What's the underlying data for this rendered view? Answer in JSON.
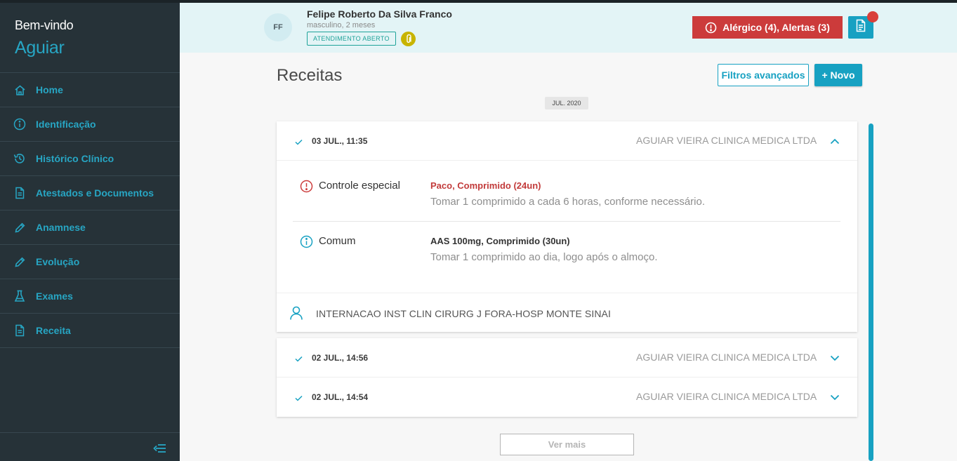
{
  "sidebar": {
    "welcome": "Bem-vindo",
    "user": "Aguiar",
    "items": [
      {
        "label": "Home",
        "icon": "home-icon"
      },
      {
        "label": "Identificação",
        "icon": "info-icon"
      },
      {
        "label": "Histórico Clínico",
        "icon": "history-icon"
      },
      {
        "label": "Atestados e Documentos",
        "icon": "document-icon"
      },
      {
        "label": "Anamnese",
        "icon": "pencil-icon"
      },
      {
        "label": "Evolução",
        "icon": "pencil-icon"
      },
      {
        "label": "Exames",
        "icon": "flask-icon"
      },
      {
        "label": "Receita",
        "icon": "document-icon"
      }
    ]
  },
  "patient": {
    "initials": "FF",
    "name": "Felipe Roberto Da Silva Franco",
    "info": "masculino, 2 meses",
    "status": "ATENDIMENTO ABERTO"
  },
  "alerts": {
    "label": "Alérgico (4),  Alertas (3)"
  },
  "main": {
    "title": "Receitas",
    "filter_label": "Filtros avançados",
    "new_label": "+ Novo",
    "month_chip": "JUL. 2020",
    "more_label": "Ver mais"
  },
  "records": [
    {
      "date": "03 JUL., 11:35",
      "clinic": "AGUIAR VIEIRA CLINICA MEDICA LTDA",
      "prescriptions": [
        {
          "type": "Controle especial",
          "med": "Paco, Comprimido (24un)",
          "instr": "Tomar 1 comprimido a cada 6 horas, conforme necessário."
        },
        {
          "type": "Comum",
          "med": "AAS 100mg, Comprimido (30un)",
          "instr": "Tomar 1 comprimido ao dia, logo após o almoço."
        }
      ],
      "hospital": "INTERNACAO INST CLIN CIRURG J FORA-HOSP MONTE SINAI"
    },
    {
      "date": "02 JUL., 14:56",
      "clinic": "AGUIAR VIEIRA CLINICA MEDICA LTDA"
    },
    {
      "date": "02 JUL., 14:54",
      "clinic": "AGUIAR VIEIRA CLINICA MEDICA LTDA"
    }
  ],
  "colors": {
    "sidebar_bg": "#263238",
    "accent": "#17a1c2",
    "alert_red": "#cc3b3b",
    "header_bg": "#e3f4f6"
  }
}
